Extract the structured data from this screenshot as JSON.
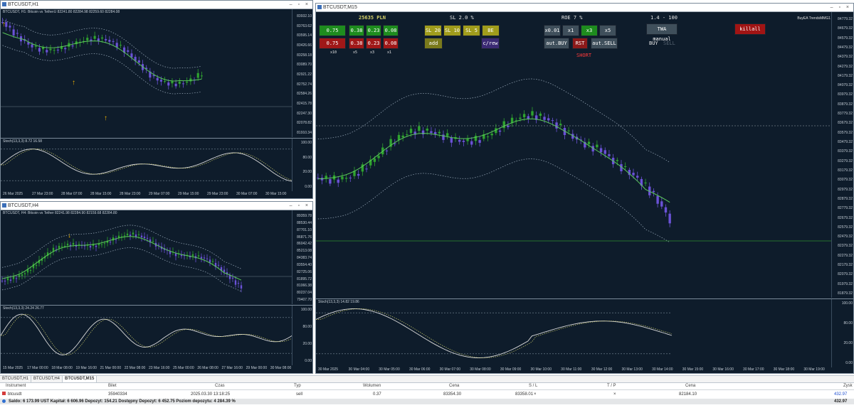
{
  "windows": {
    "h1": {
      "title": "BTCUSDT,H1",
      "info": "BTCUSDT, H1: Bitcoin vs TetherU 82241.80 82284.98 82259.60 82284.08",
      "price_ticks": [
        "83932.10",
        "83763.62",
        "83595.14",
        "83426.66",
        "83258.18",
        "83089.70",
        "82921.22",
        "82752.74",
        "82584.26",
        "82415.78",
        "82247.30",
        "82078.82",
        "81910.34"
      ],
      "stoch_info": "Stoch(13,3,3) 8.72 16.58",
      "stoch_ticks": [
        "100.00",
        "80.00",
        "20.00",
        "0.00"
      ],
      "time_ticks": [
        "26 Mar 2025",
        "27 Mar 23:00",
        "28 Mar 07:00",
        "28 Mar 15:00",
        "28 Mar 23:00",
        "29 Mar 07:00",
        "29 Mar 15:00",
        "29 Mar 23:00",
        "30 Mar 07:00",
        "30 Mar 15:00"
      ]
    },
    "h4": {
      "title": "BTCUSDT,H4",
      "info": "BTCUSDT, H4: Bitcoin vs Tether 82241.98 82284.90 82159.68 82284.80",
      "price_ticks": [
        "89359.78",
        "88530.44",
        "87701.10",
        "86871.76",
        "86042.42",
        "85213.08",
        "84383.74",
        "83554.40",
        "82725.06",
        "81895.72",
        "81066.38",
        "80237.04",
        "79407.70"
      ],
      "stoch_info": "Stoch(13,3,3) 24.24 26.77",
      "stoch_ticks": [
        "100.00",
        "80.00",
        "20.00",
        "0.00"
      ],
      "time_ticks": [
        "15 Mar 2025",
        "17 Mar 00:00",
        "18 Mar 08:00",
        "19 Mar 16:00",
        "21 Mar 00:00",
        "22 Mar 08:00",
        "23 Mar 16:00",
        "25 Mar 00:00",
        "26 Mar 08:00",
        "27 Mar 16:00",
        "29 Mar 00:00",
        "30 Mar 08:00"
      ]
    },
    "m15": {
      "title": "BTCUSDT,M15",
      "stoch_info": "Stoch(13,3,3) 14.82 19.86",
      "price_ticks": [
        "84779.32",
        "84679.32",
        "84579.32",
        "84479.32",
        "84379.32",
        "84279.32",
        "84179.32",
        "84079.32",
        "83979.32",
        "83879.32",
        "83779.32",
        "83679.32",
        "83579.32",
        "83479.32",
        "83379.32",
        "83279.32",
        "83179.32",
        "83079.32",
        "82979.32",
        "82879.32",
        "82779.32",
        "82679.32",
        "82579.32",
        "82479.32",
        "82379.32",
        "82279.32",
        "82179.32",
        "82079.32",
        "81979.32",
        "81879.32"
      ],
      "stoch_ticks": [
        "100.00",
        "80.00",
        "20.00",
        "0.00"
      ],
      "time_ticks": [
        "30 Mar 2025",
        "30 Mar 04:00",
        "30 Mar 05:00",
        "30 Mar 06:00",
        "30 Mar 07:00",
        "30 Mar 08:00",
        "30 Mar 09:00",
        "30 Mar 10:00",
        "30 Mar 11:00",
        "30 Mar 12:00",
        "30 Mar 13:00",
        "30 Mar 14:00",
        "30 Mar 15:00",
        "30 Mar 16:00",
        "30 Mar 17:00",
        "30 Mar 18:00",
        "30 Mar 19:00"
      ],
      "ea_label": "BuyEA TrendsMMG1"
    }
  },
  "panel": {
    "balance": "25635 PLN",
    "sl": "SL 2.0 %",
    "roe": "ROE 7 %",
    "ratio": "1.4 - 100",
    "buy_row": [
      "0.75",
      "0.38",
      "0.23",
      "0.08"
    ],
    "sell_row": [
      "0.75",
      "0.38",
      "0.23",
      "0.08"
    ],
    "qty_labels": [
      "x10",
      "x5",
      "x3",
      "x1"
    ],
    "sl_buttons": [
      "SL 20",
      "SL 10",
      "SL 5",
      "BE"
    ],
    "add": "add",
    "crew": "c/rew",
    "mult": [
      "x0.01",
      "x1",
      "x3",
      "x5"
    ],
    "aut_buy": "aut.BUY",
    "rst": "RST",
    "aut_sell": "aut.SELL",
    "short": "SHORT",
    "twa": "TWA manual",
    "buy": "BUY",
    "sell": "SELL",
    "kill": "killall"
  },
  "tabs": [
    "BTCUSDT,H1",
    "BTCUSDT,H4",
    "BTCUSDT,M15"
  ],
  "terminal": {
    "headers": [
      "Instrument",
      "Bilet",
      "Czas",
      "Typ",
      "Wolumen",
      "Cena",
      "S / L",
      "T / P",
      "Cena",
      "Zysk"
    ],
    "row": [
      "btcusdt",
      "35940334",
      "2025.03.30 13:18:25",
      "sell",
      "0.37",
      "83354.30",
      "83358.01",
      "",
      "82184.10",
      "432.97"
    ],
    "balance_line": "Saldo: 6 173.99 UST   Kapitał: 6 606.96   Depozyt: 154.21   Dostępny Depozyt: 6 452.75   Poziom depozytu: 4 284.39 %",
    "total": "432.97"
  },
  "colors": {
    "bg": "#0e1c2b",
    "bull": "#2fa32f",
    "bear": "#6a52d6",
    "ma": "#5ac85a"
  }
}
